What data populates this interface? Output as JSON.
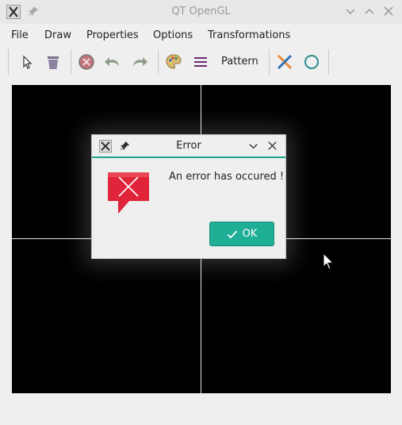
{
  "window": {
    "title": "QT OpenGL",
    "logo_icon": "x-window-icon",
    "pin_icon": "pin-icon",
    "controls": [
      "minimize-icon",
      "maximize-icon",
      "close-icon"
    ]
  },
  "menu": {
    "items": [
      "File",
      "Draw",
      "Properties",
      "Options",
      "Transformations"
    ]
  },
  "toolbar": {
    "pattern_label": "Pattern",
    "icons": [
      "pointer-icon",
      "trash-icon",
      "cancel-icon",
      "undo-icon",
      "redo-icon",
      "palette-icon",
      "line-width-icon",
      "pattern-text",
      "cross-lines-icon",
      "circle-icon"
    ]
  },
  "dialog": {
    "title": "Error",
    "message": "An error has occured !",
    "ok_label": "OK",
    "accent_color": "#1aa58e",
    "icon": "error-bubble-icon"
  },
  "colors": {
    "canvas_background": "#000000",
    "axes": "#e6e6e6",
    "ok_button": "#1fae96",
    "error_icon": "#e0243a"
  }
}
